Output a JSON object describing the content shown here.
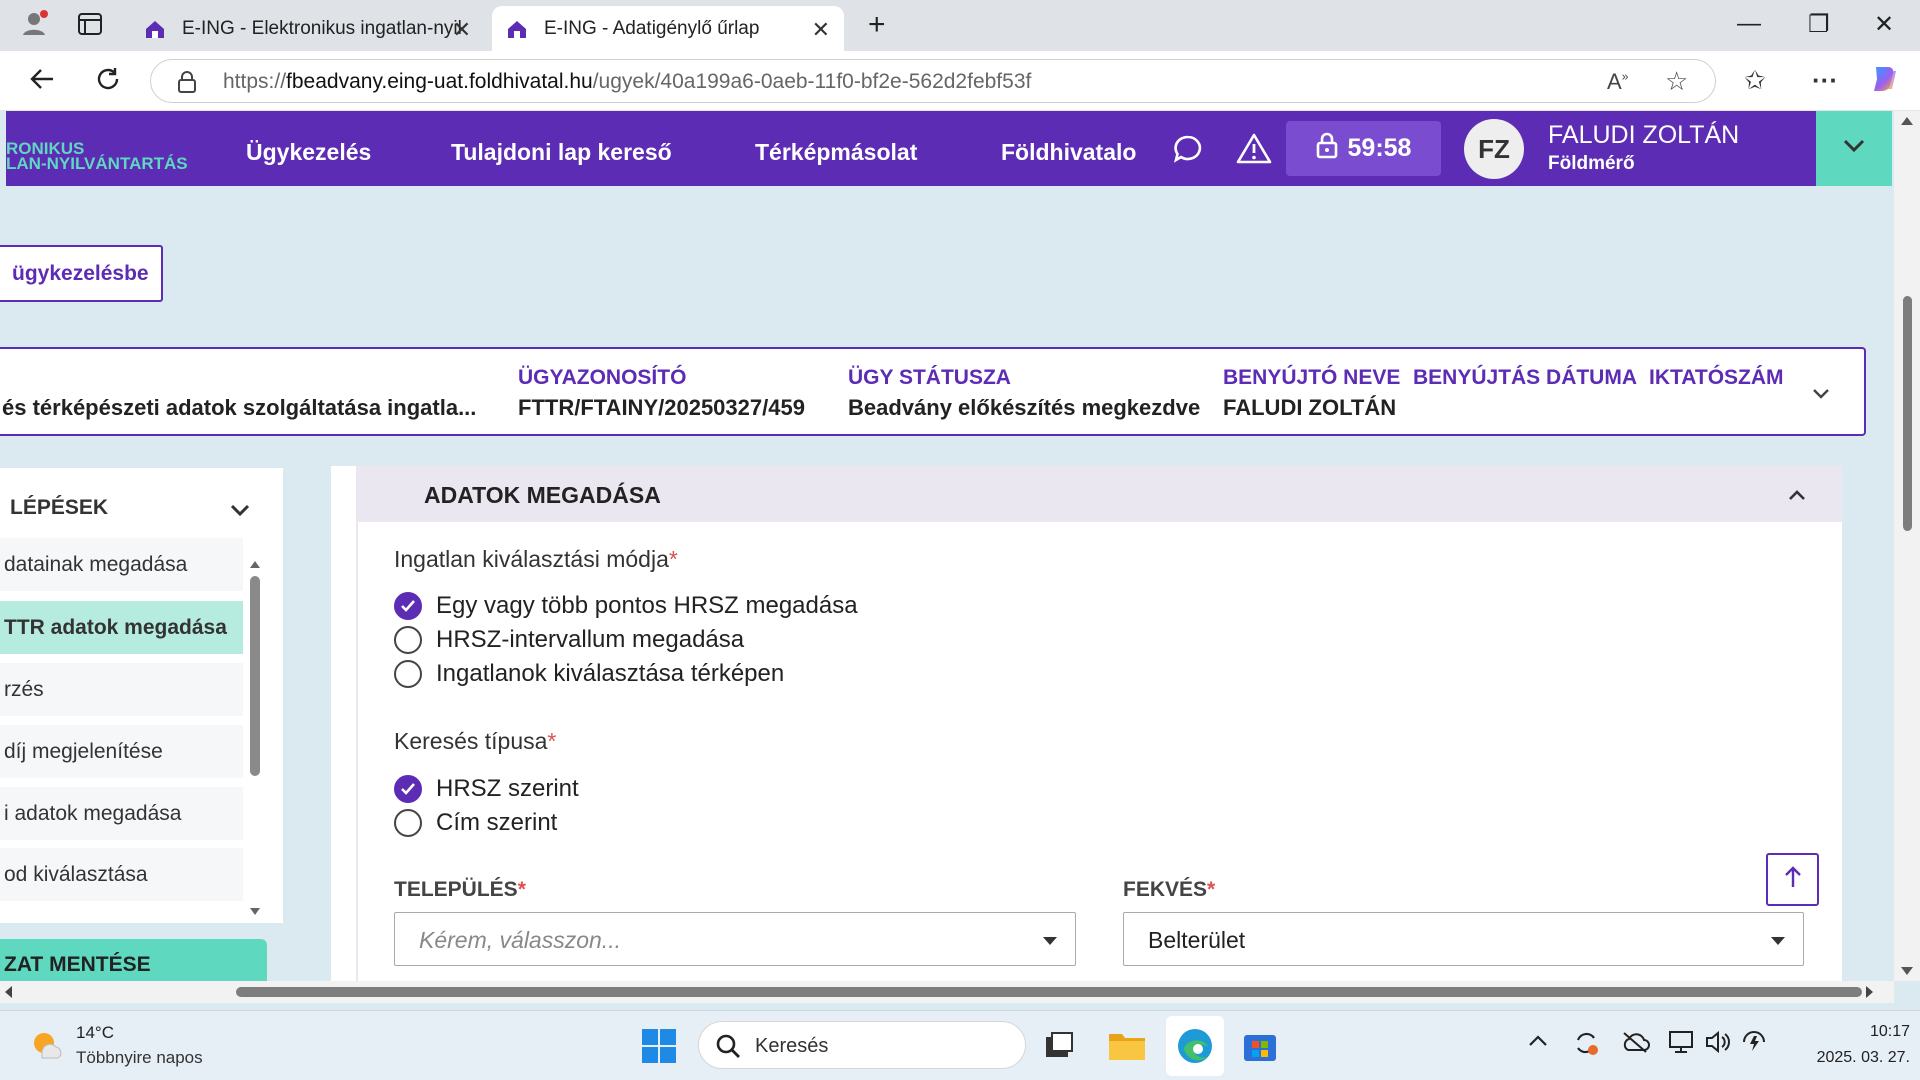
{
  "browser": {
    "tabs": [
      {
        "title": "E-ING - Elektronikus ingatlan-nyil",
        "active": false
      },
      {
        "title": "E-ING - Adatigénylő űrlap",
        "active": true
      }
    ],
    "url_prefix": "https://",
    "url_host": "fbeadvany.eing-uat.foldhivatal.hu",
    "url_path": "/ugyek/40a199a6-0aeb-11f0-bf2e-562d2febf53f"
  },
  "app": {
    "brand_line1": "RONIKUS",
    "brand_line2": "LAN-NYILVÁNTARTÁS",
    "menu": [
      "Ügykezelés",
      "Tulajdoni lap kereső",
      "Térképmásolat",
      "Földhivatalo"
    ],
    "timer": "59:58",
    "user_initials": "FZ",
    "user_name": "FALUDI ZOLTÁN",
    "user_role": "Földmérő",
    "colors": {
      "primary": "#5d2cb4",
      "accent": "#5fd8c0"
    }
  },
  "back_button": "ügykezelésbe",
  "case": {
    "title_value": "és térképészeti adatok szolgáltatása ingatla...",
    "fields": [
      {
        "label": "ÜGYAZONOSÍTÓ",
        "value": "FTTR/FTAINY/20250327/459"
      },
      {
        "label": "ÜGY STÁTUSZA",
        "value": "Beadvány előkészítés megkezdve"
      },
      {
        "label": "BENYÚJTÓ NEVE",
        "value": "FALUDI ZOLTÁN"
      },
      {
        "label": "BENYÚJTÁS DÁTUMA",
        "value": ""
      },
      {
        "label": "IKTATÓSZÁM",
        "value": ""
      }
    ]
  },
  "steps": {
    "header": "LÉPÉSEK",
    "items": [
      {
        "label": "datainak megadása",
        "active": false
      },
      {
        "label": "TTR adatok megadása",
        "active": true
      },
      {
        "label": "rzés",
        "active": false
      },
      {
        "label": "díj megjelenítése",
        "active": false
      },
      {
        "label": "i adatok megadása",
        "active": false
      },
      {
        "label": "od kiválasztása",
        "active": false
      }
    ],
    "save_button": "ZAT MENTÉSE"
  },
  "section": {
    "title": "ADATOK MEGADÁSA",
    "selection_mode": {
      "label": "Ingatlan kiválasztási módja",
      "options": [
        {
          "label": "Egy vagy több pontos HRSZ megadása",
          "selected": true
        },
        {
          "label": "HRSZ-intervallum megadása",
          "selected": false
        },
        {
          "label": "Ingatlanok kiválasztása térképen",
          "selected": false
        }
      ]
    },
    "search_type": {
      "label": "Keresés típusa",
      "options": [
        {
          "label": "HRSZ szerint",
          "selected": true
        },
        {
          "label": "Cím szerint",
          "selected": false
        }
      ]
    },
    "settlement": {
      "label": "TELEPÜLÉS",
      "placeholder": "Kérem, válasszon..."
    },
    "location": {
      "label": "FEKVÉS",
      "value": "Belterület"
    }
  },
  "taskbar": {
    "weather_temp": "14°C",
    "weather_desc": "Többnyire napos",
    "search_placeholder": "Keresés",
    "time": "10:17",
    "date": "2025. 03. 27."
  }
}
